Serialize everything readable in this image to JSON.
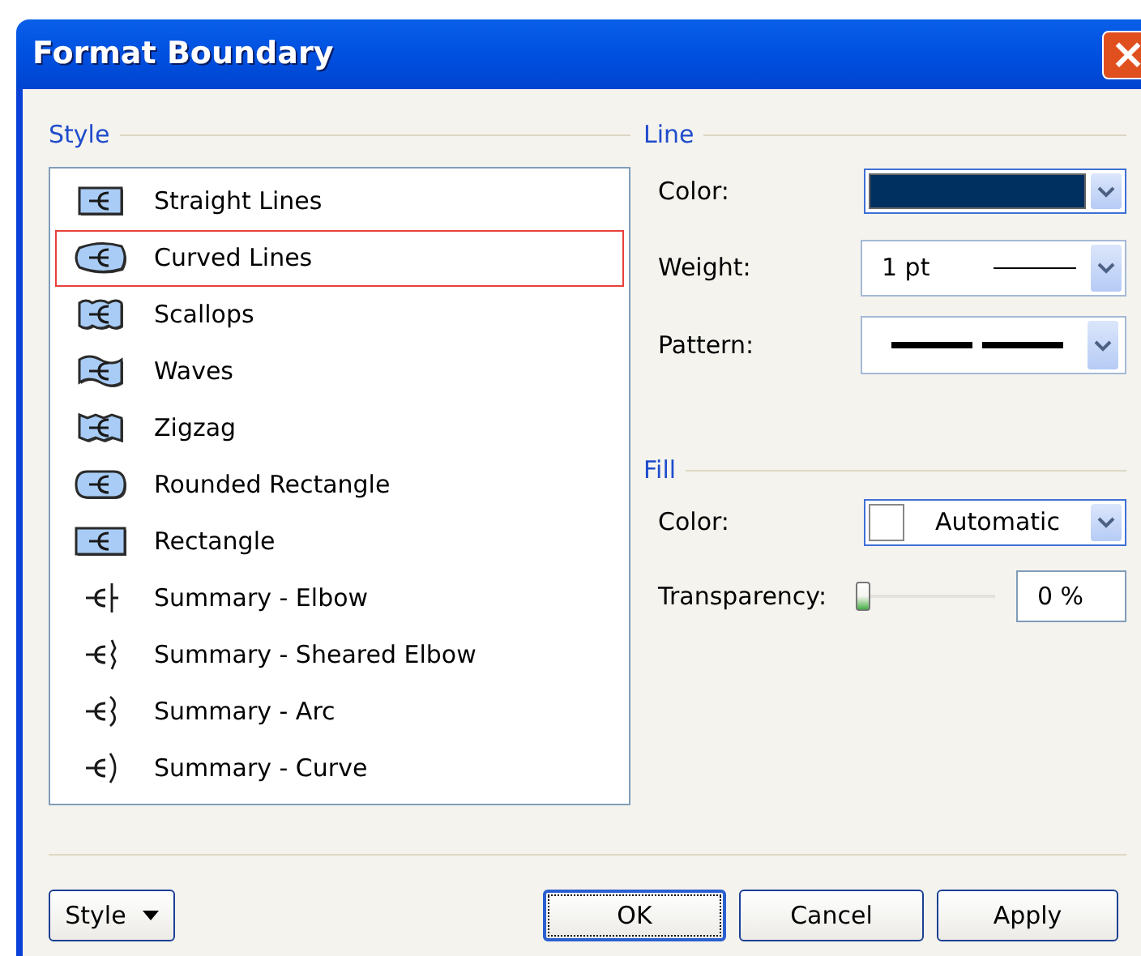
{
  "window": {
    "title": "Format Boundary",
    "close": "×"
  },
  "style": {
    "label": "Style",
    "items": [
      {
        "label": "Straight Lines",
        "kind": "shape",
        "selected": false
      },
      {
        "label": "Curved Lines",
        "kind": "shape",
        "selected": true
      },
      {
        "label": "Scallops",
        "kind": "shape",
        "selected": false
      },
      {
        "label": "Waves",
        "kind": "shape",
        "selected": false
      },
      {
        "label": "Zigzag",
        "kind": "shape",
        "selected": false
      },
      {
        "label": "Rounded Rectangle",
        "kind": "shape",
        "selected": false
      },
      {
        "label": "Rectangle",
        "kind": "shape",
        "selected": false
      },
      {
        "label": "Summary - Elbow",
        "kind": "summary",
        "selected": false
      },
      {
        "label": "Summary - Sheared Elbow",
        "kind": "summary",
        "selected": false
      },
      {
        "label": "Summary - Arc",
        "kind": "summary",
        "selected": false
      },
      {
        "label": "Summary - Curve",
        "kind": "summary",
        "selected": false
      }
    ]
  },
  "line": {
    "label": "Line",
    "color": {
      "label": "Color:",
      "color": "#003060"
    },
    "weight": {
      "label": "Weight:",
      "value": "1 pt"
    },
    "pattern": {
      "label": "Pattern:"
    }
  },
  "fill": {
    "label": "Fill",
    "color": {
      "label": "Color:",
      "value": "Automatic"
    },
    "transparency": {
      "label": "Transparency:",
      "level": 0,
      "value": "0 %"
    }
  },
  "buttons": [
    {
      "label": "Style",
      "kind": "menu",
      "default": false
    },
    {
      "label": "OK",
      "kind": "push",
      "default": true
    },
    {
      "label": "Cancel",
      "kind": "push",
      "default": false
    },
    {
      "label": "Apply",
      "kind": "push",
      "default": false
    }
  ]
}
